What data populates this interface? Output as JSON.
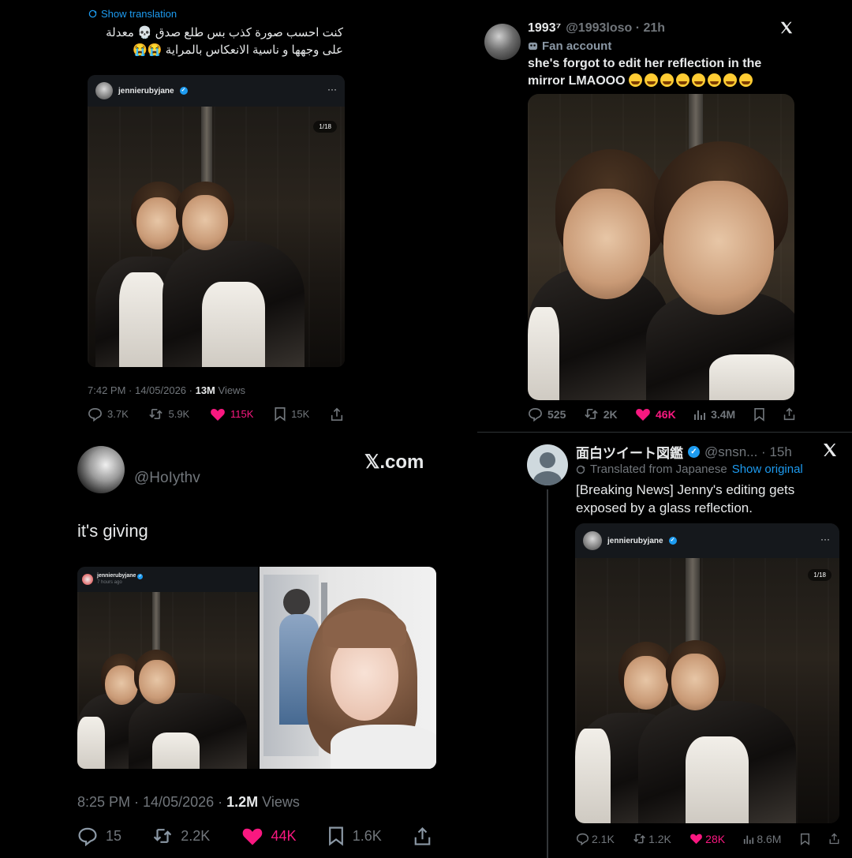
{
  "q1": {
    "show_translation": "Show translation",
    "text_line1": "كنت احسب صورة كذب بس طلع صدق 💀 معدلة",
    "text_line2": "على وجهها و ناسية الانعكاس بالمراية 😭😭",
    "card_username": "jennierubyjane",
    "card_menu": "···",
    "photo_counter": "1/18",
    "time": "7:42 PM · 14/05/2026 · ",
    "views_count": "13M",
    "views_label": " Views",
    "replies": "3.7K",
    "reposts": "5.9K",
    "likes": "115K",
    "bookmarks": "15K"
  },
  "q2": {
    "display_name": "1993⁷",
    "handle_time": "@1993loso · 21h",
    "fan_account": "Fan account",
    "text_line1": "she's forgot to edit her reflection in the",
    "text_line2": "mirror LMAOOO",
    "emoji_count": 8,
    "replies": "525",
    "reposts": "2K",
    "likes": "46K",
    "views": "3.4M"
  },
  "q3": {
    "handle": "@HoIythv",
    "xcom": "𝕏.com",
    "text": "it's giving",
    "card_username": "jennierubyjane",
    "card_time": "7 hours ago",
    "time": "8:25 PM · 14/05/2026 · ",
    "views_count": "1.2M",
    "views_label": " Views",
    "replies": "15",
    "reposts": "2.2K",
    "likes": "44K",
    "bookmarks": "1.6K"
  },
  "q4": {
    "display_name": "面白ツイート図鑑",
    "handle_time": "@snsn... · 15h",
    "translated": "Translated from Japanese",
    "show_original": "Show original",
    "text_line1": "[Breaking News] Jenny's editing gets",
    "text_line2": "exposed by a glass reflection.",
    "card_username": "jennierubyjane",
    "card_menu": "···",
    "photo_counter": "1/18",
    "replies": "2.1K",
    "reposts": "1.2K",
    "likes": "28K",
    "views": "8.6M"
  },
  "colors": {
    "accent": "#1d9bf0",
    "like": "#f91880",
    "muted": "#71767b",
    "background": "#000000"
  }
}
